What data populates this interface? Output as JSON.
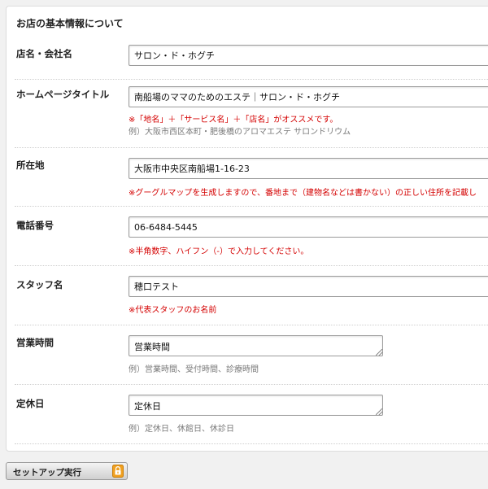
{
  "panel": {
    "title": "お店の基本情報について"
  },
  "fields": {
    "shop_name": {
      "label": "店名・会社名",
      "value": "サロン・ド・ホグチ"
    },
    "homepage_title": {
      "label": "ホームページタイトル",
      "value": "南船場のママのためのエステ｜サロン・ド・ホグチ",
      "note": "※「地名」＋「サービス名」＋「店名」がオススメです。",
      "example": "例）大阪市西区本町・肥後橋のアロマエステ サロンドリウム"
    },
    "address": {
      "label": "所在地",
      "value": "大阪市中央区南船場1-16-23",
      "note": "※グーグルマップを生成しますので、番地まで（建物名などは書かない）の正しい住所を記載し"
    },
    "phone": {
      "label": "電話番号",
      "value": "06-6484-5445",
      "note": "※半角数字、ハイフン（-）で入力してください。"
    },
    "staff_name": {
      "label": "スタッフ名",
      "value": "穂口テスト",
      "note": "※代表スタッフのお名前"
    },
    "business_hours": {
      "label": "営業時間",
      "value": "営業時間",
      "example": "例）営業時間、受付時間、診療時間"
    },
    "holidays": {
      "label": "定休日",
      "value": "定休日",
      "example": "例）定休日、休館日、休診日"
    }
  },
  "actions": {
    "setup_label": "セットアップ実行"
  },
  "colors": {
    "note_red": "#d40000",
    "example_gray": "#7a7a7a",
    "lock_orange": "#f0a020"
  },
  "icons": {
    "setup": "lock-icon"
  }
}
